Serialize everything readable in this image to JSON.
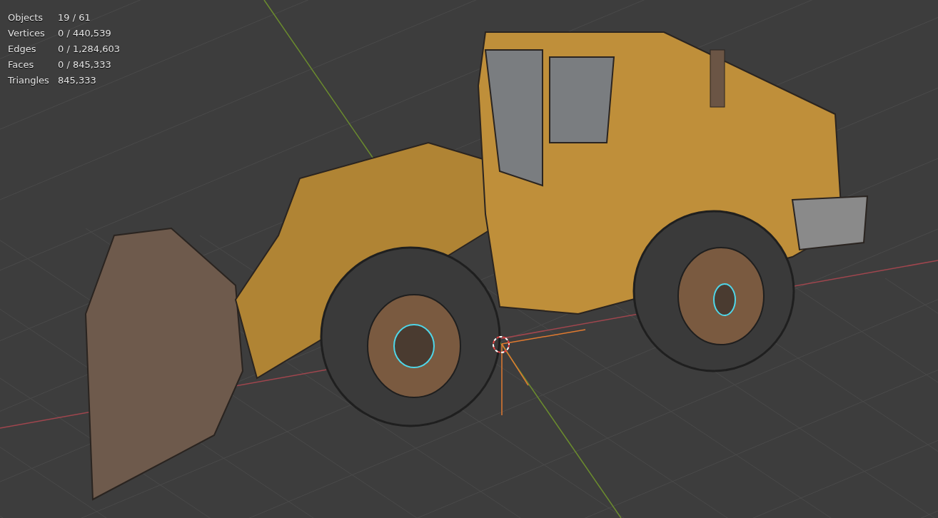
{
  "stats": [
    {
      "label": "Objects",
      "value": "19 / 61"
    },
    {
      "label": "Vertices",
      "value": "0 / 440,539"
    },
    {
      "label": "Edges",
      "value": "0 / 1,284,603"
    },
    {
      "label": "Faces",
      "value": "0 / 845,333"
    },
    {
      "label": "Triangles",
      "value": "845,333"
    }
  ]
}
